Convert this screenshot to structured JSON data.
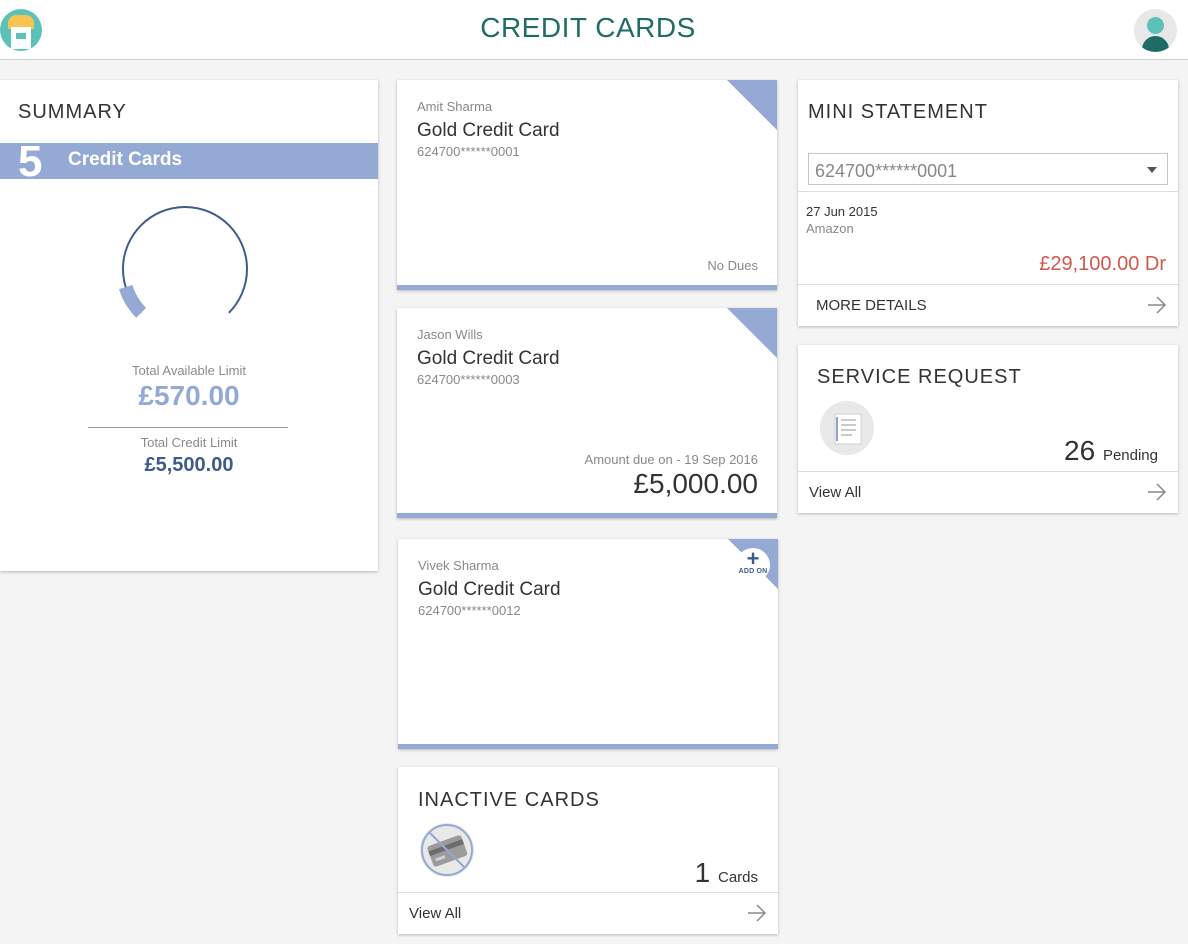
{
  "header": {
    "title": "CREDIT CARDS",
    "logo_icon": "bank-logo-icon",
    "avatar_icon": "user-avatar-icon"
  },
  "summary": {
    "title": "SUMMARY",
    "card_count": "5",
    "card_count_label": "Credit Cards",
    "available_limit_label": "Total Available Limit",
    "available_limit": "£570.00",
    "credit_limit_label": "Total Credit Limit",
    "credit_limit": "£5,500.00",
    "gauge_fraction_available": 0.104
  },
  "cards": [
    {
      "holder": "Amit Sharma",
      "type": "Gold Credit Card",
      "number": "624700******0001",
      "status": "No Dues",
      "due_label": "",
      "due_amount": "",
      "addon": false
    },
    {
      "holder": "Jason Wills",
      "type": "Gold Credit Card",
      "number": "624700******0003",
      "status": "",
      "due_label": "Amount due on - 19 Sep 2016",
      "due_amount": "£5,000.00",
      "addon": false
    },
    {
      "holder": "Vivek Sharma",
      "type": "Gold Credit Card",
      "number": "624700******0012",
      "status": "",
      "due_label": "",
      "due_amount": "",
      "addon": true,
      "addon_label": "ADD ON"
    }
  ],
  "inactive_cards": {
    "title": "INACTIVE CARDS",
    "count": "1",
    "count_label": "Cards",
    "link": "View All",
    "icon": "inactive-card-icon"
  },
  "mini_statement": {
    "title": "MINI STATEMENT",
    "selected_card": "624700******0001",
    "date": "27 Jun 2015",
    "description": "Amazon",
    "amount": "£29,100.00 Dr",
    "link": "MORE DETAILS"
  },
  "service_request": {
    "title": "SERVICE REQUEST",
    "count": "26",
    "count_label": "Pending",
    "link": "View All",
    "icon": "document-icon"
  },
  "colors": {
    "accent": "#94a9d3",
    "title": "#1f6b66",
    "debit": "#d2584e",
    "dark_blue": "#3d5c8a"
  }
}
